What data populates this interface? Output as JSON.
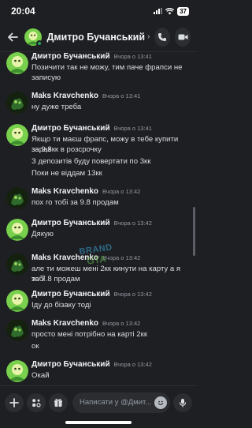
{
  "status_bar": {
    "time": "20:04",
    "battery": "37"
  },
  "header": {
    "title": "Дмитро Бучанський",
    "chevron": "›"
  },
  "colors": {
    "background": "#1e1f22",
    "online": "#23a55a",
    "avatar_green": "#78d04c",
    "avatar_dark": "#2f6b2b"
  },
  "messages": [
    {
      "author": "Дмитро Бучанський",
      "time": "Вчора о 13:41",
      "avatar": "green-avatar",
      "lines": [
        "Позичити так не можу, тим паче фрапси не",
        "записую"
      ]
    },
    {
      "author": "Maks Kravchenko",
      "time": "Вчора о 13:41",
      "avatar": "dark-avatar",
      "lines": [
        "ну дуже треба"
      ]
    },
    {
      "author": "Дмитро Бучанський",
      "time": "Вчора о 13:41",
      "avatar": "green-avatar",
      "lines": [
        "Якщо ти маєш фрапс, можу в тебе купити зараз",
        "за 9,8кк в розсрочку",
        "З депозитів буду повертати по 3кк",
        "Поки не віддам 13кк"
      ]
    },
    {
      "author": "Maks Kravchenko",
      "time": "Вчора о 13:42",
      "avatar": "dark-avatar",
      "lines": [
        "пох го тобі за 9.8 продам"
      ]
    },
    {
      "author": "Дмитро Бучанський",
      "time": "Вчора о 13:42",
      "avatar": "green-avatar",
      "lines": [
        "Дякую"
      ]
    },
    {
      "author": "Maks Kravchenko",
      "time": "Вчора о 13:42",
      "avatar": "dark-avatar",
      "lines": [
        "але ти можеш мені 2кк кинути на карту а я тобі",
        "за 7.8 продам"
      ]
    },
    {
      "author": "Дмитро Бучанський",
      "time": "Вчора о 13:42",
      "avatar": "green-avatar",
      "lines": [
        "Іду до бізаку тоді"
      ]
    },
    {
      "author": "Maks Kravchenko",
      "time": "Вчора о 13:42",
      "avatar": "dark-avatar",
      "lines": [
        "просто мені потрібно на карті 2кк",
        "ок"
      ]
    },
    {
      "author": "Дмитро Бучанський",
      "time": "Вчора о 13:42",
      "avatar": "green-avatar",
      "lines": [
        "Окай"
      ]
    }
  ],
  "watermark": {
    "line1": "BRAND",
    "line2": "GTA"
  },
  "composer": {
    "placeholder": "Написати у @Дмит..."
  }
}
